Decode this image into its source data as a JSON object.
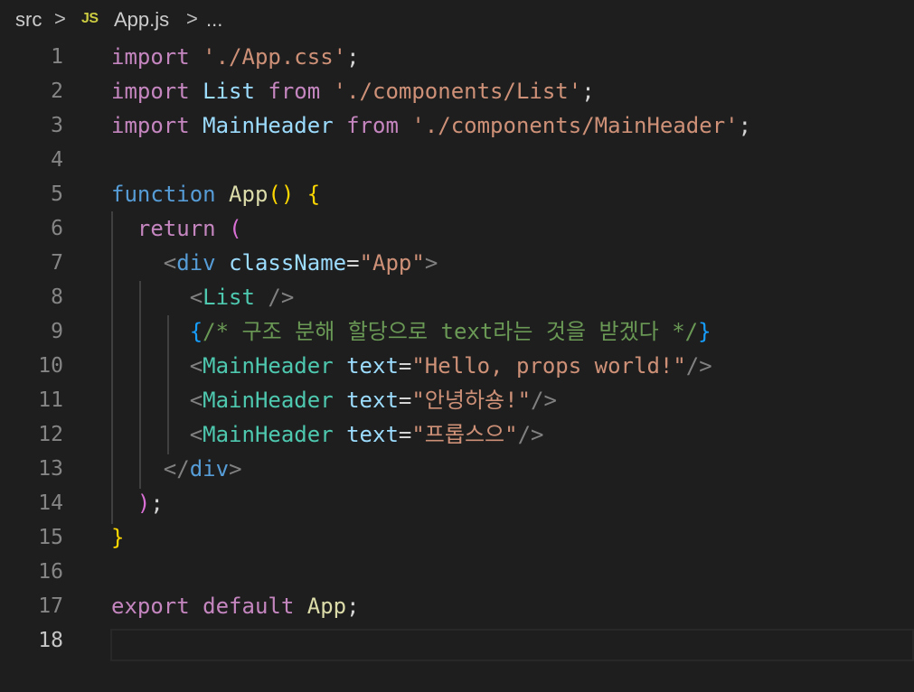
{
  "breadcrumb": {
    "folder": "src",
    "file_icon": "JS",
    "file": "App.js",
    "more": "...",
    "separator": ">"
  },
  "editor": {
    "language": "javascript",
    "active_line": 18,
    "line_numbers": [
      "1",
      "2",
      "3",
      "4",
      "5",
      "6",
      "7",
      "8",
      "9",
      "10",
      "11",
      "12",
      "13",
      "14",
      "15",
      "16",
      "17",
      "18"
    ],
    "lines": [
      "import './App.css';",
      "import List from './components/List';",
      "import MainHeader from './components/MainHeader';",
      "",
      "function App() {",
      "  return (",
      "    <div className=\"App\">",
      "      <List />",
      "      {/* 구조 분해 할당으로 text라는 것을 받겠다 */}",
      "      <MainHeader text=\"Hello, props world!\"/>",
      "      <MainHeader text=\"안녕하숑!\"/>",
      "      <MainHeader text=\"프롭스으\"/>",
      "    </div>",
      "  );",
      "}",
      "",
      "export default App;",
      ""
    ]
  },
  "colors": {
    "background": "#1e1e1e",
    "keyword": "#c586c0",
    "storage": "#569cd6",
    "string": "#ce9178",
    "variable": "#9cdcfe",
    "function": "#dcdcaa",
    "component": "#4ec9b0",
    "comment": "#6a9955",
    "bracket_gold": "#ffd700",
    "bracket_purple": "#da70d6",
    "bracket_blue": "#179fff",
    "line_number": "#858585"
  }
}
